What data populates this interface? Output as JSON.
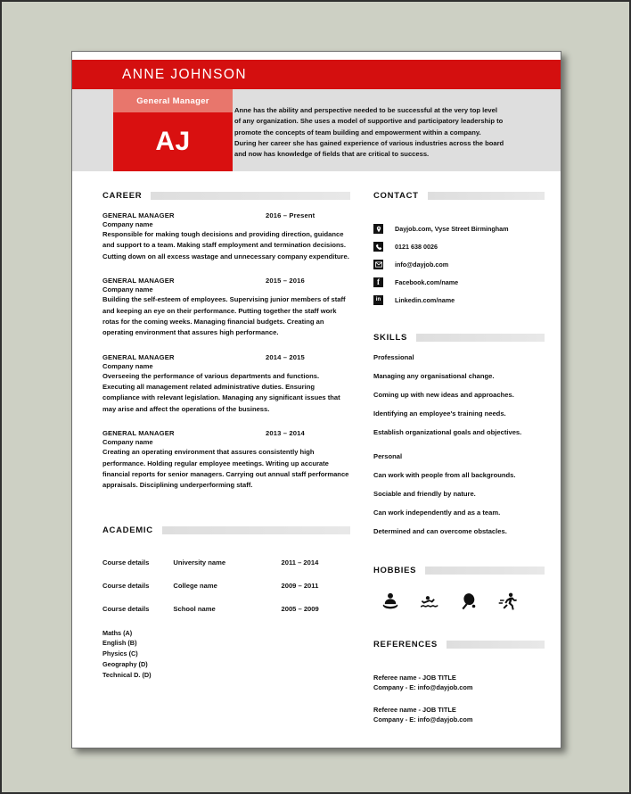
{
  "theme": {
    "page_bg": "#cdd0c4",
    "banner_red": "#d40f0f",
    "jobtitle_red": "#e8766c",
    "initials_red": "#d91010",
    "hero_grey": "#dedede",
    "rule_grey": "#dedede",
    "text": "#111111"
  },
  "header": {
    "name": "ANNE JOHNSON",
    "job_title": "General Manager",
    "initials": "AJ",
    "profile": [
      "Anne has the ability and perspective needed to be successful at the very top level",
      "of any organization. She uses a model of supportive and participatory leadership to",
      "promote the concepts of team building and empowerment within a company.",
      "During her career she has gained experience of various industries across the board",
      "and now has knowledge of fields that are critical to success."
    ]
  },
  "career": {
    "heading": "CAREER",
    "jobs": [
      {
        "role": "GENERAL MANAGER",
        "dates": "2016 – Present",
        "company": "Company name",
        "description": "Responsible for making tough decisions and providing direction, guidance and support to a team. Making staff employment and termination decisions. Cutting down on all excess wastage and unnecessary company expenditure."
      },
      {
        "role": "GENERAL MANAGER",
        "dates": "2015 – 2016",
        "company": "Company name",
        "description": "Building the self-esteem of employees. Supervising junior members of staff and keeping an eye on their performance. Putting together the staff work rotas for the coming weeks. Managing financial budgets. Creating an operating environment that assures high performance."
      },
      {
        "role": "GENERAL MANAGER",
        "dates": "2014 – 2015",
        "company": "Company name",
        "description": "Overseeing the performance of various departments and functions. Executing all management related administrative duties. Ensuring compliance with relevant legislation. Managing any significant issues that may arise and affect the operations of the business."
      },
      {
        "role": "GENERAL MANAGER",
        "dates": "2013 – 2014",
        "company": "Company name",
        "description": "Creating an operating environment that assures consistently high performance. Holding regular employee meetings. Writing up accurate financial reports for senior managers. Carrying out annual staff performance appraisals. Disciplining underperforming staff."
      }
    ]
  },
  "academic": {
    "heading": "ACADEMIC",
    "rows": [
      {
        "course": "Course details",
        "institution": "University name",
        "dates": "2011 – 2014"
      },
      {
        "course": "Course details",
        "institution": "College name",
        "dates": "2009 – 2011"
      },
      {
        "course": "Course details",
        "institution": "School name",
        "dates": "2005 – 2009"
      }
    ],
    "grades": [
      "Maths (A)",
      "English (B)",
      "Physics (C)",
      "Geography (D)",
      "Technical D. (D)"
    ]
  },
  "contact": {
    "heading": "CONTACT",
    "rows": [
      {
        "icon": "location-pin-icon",
        "text": "Dayjob.com, Vyse Street Birmingham"
      },
      {
        "icon": "phone-icon",
        "text": "0121 638 0026"
      },
      {
        "icon": "email-icon",
        "text": "info@dayjob.com"
      },
      {
        "icon": "facebook-icon",
        "text": "Facebook.com/name"
      },
      {
        "icon": "linkedin-icon",
        "text": "Linkedin.com/name"
      }
    ]
  },
  "skills": {
    "heading": "SKILLS",
    "professional_label": "Professional",
    "professional": [
      "Managing any organisational change.",
      "Coming up with new ideas and approaches.",
      "Identifying an employee's training needs.",
      "Establish organizational goals and objectives."
    ],
    "personal_label": "Personal",
    "personal": [
      "Can work with people from all backgrounds.",
      "Sociable and friendly by nature.",
      "Can work independently and as a team.",
      "Determined and can overcome obstacles."
    ]
  },
  "hobbies": {
    "heading": "HOBBIES",
    "icons": [
      "reading-icon",
      "swimming-icon",
      "table-tennis-icon",
      "running-icon"
    ]
  },
  "references": {
    "heading": "REFERENCES",
    "items": [
      {
        "line1": "Referee name - JOB TITLE",
        "line2": "Company - E: info@dayjob.com"
      },
      {
        "line1": "Referee name - JOB TITLE",
        "line2": "Company - E: info@dayjob.com"
      }
    ]
  }
}
